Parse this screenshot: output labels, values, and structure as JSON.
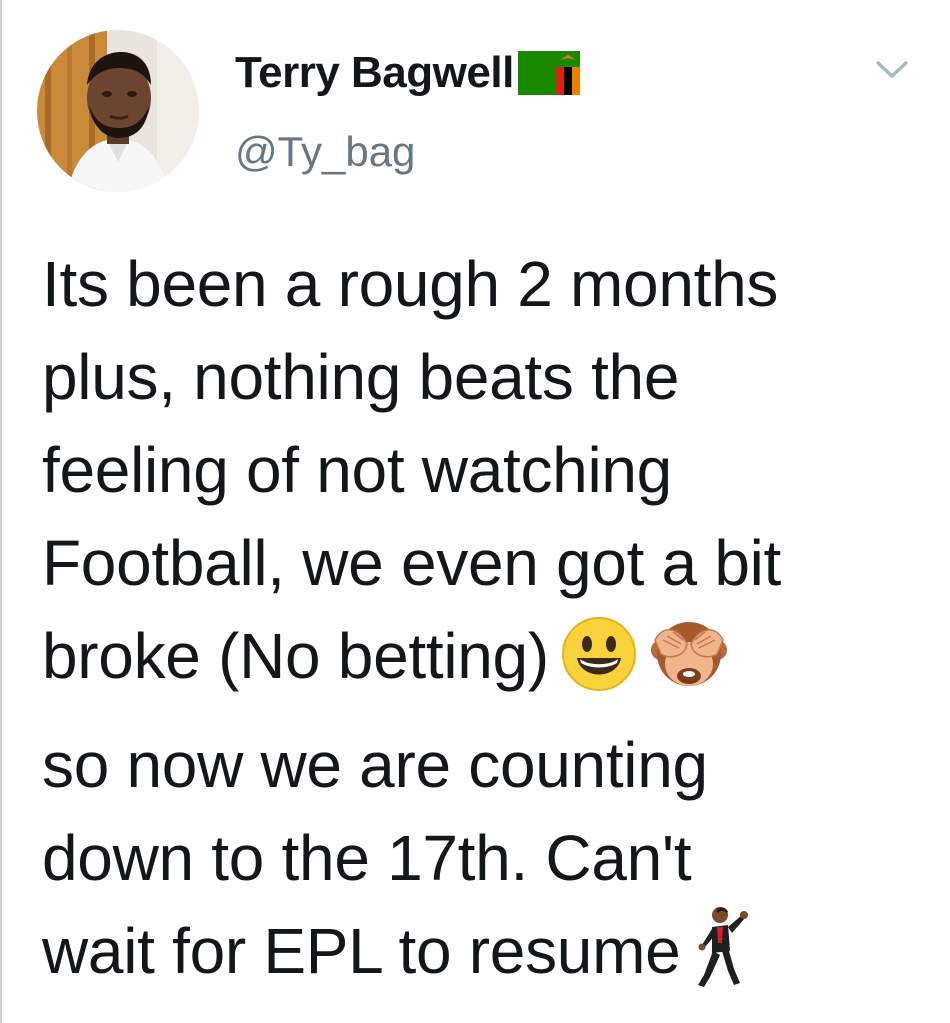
{
  "tweet": {
    "author": {
      "name": "Terry Bagwell",
      "handle": "@Ty_bag",
      "flag_icon": "zambia-flag-icon",
      "avatar_icon": "profile-photo"
    },
    "menu_icon": "chevron-down-icon",
    "text_lines": [
      "Its been a rough 2 months",
      "plus, nothing beats the",
      "feeling of not watching",
      "Football, we even got a bit",
      "broke (No betting)",
      "so now we are counting",
      "down to the 17th. Can't",
      "wait for EPL to resume"
    ],
    "emojis": [
      "grinning-face-icon",
      "see-no-evil-monkey-icon",
      "dancing-man-icon"
    ]
  },
  "colors": {
    "text": "#14171a",
    "secondary_text": "#657786",
    "flag_green": "#198a00",
    "flag_red": "#de2010",
    "flag_orange": "#ef7d00",
    "chevron": "#aab8c2"
  }
}
